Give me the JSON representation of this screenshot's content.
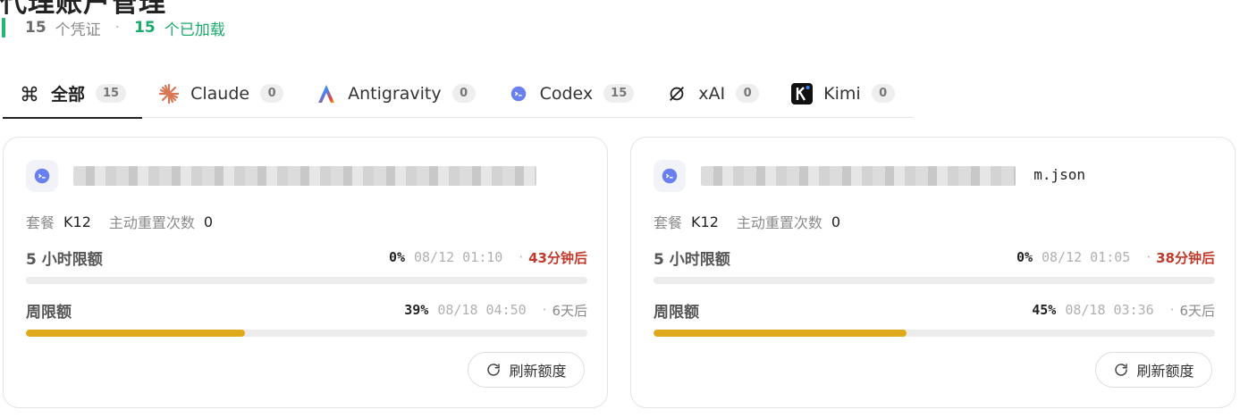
{
  "page": {
    "title": "代理账户管理"
  },
  "stats": {
    "total": "15",
    "total_label": "个凭证",
    "dot": "·",
    "loaded": "15",
    "loaded_label": "个已加载"
  },
  "tabs": [
    {
      "label": "全部",
      "count": "15",
      "icon": "command-icon",
      "active": true
    },
    {
      "label": "Claude",
      "count": "0",
      "icon": "claude-spark-icon"
    },
    {
      "label": "Antigravity",
      "count": "0",
      "icon": "antigravity-icon"
    },
    {
      "label": "Codex",
      "count": "15",
      "icon": "codex-icon"
    },
    {
      "label": "xAI",
      "count": "0",
      "icon": "xai-icon"
    },
    {
      "label": "Kimi",
      "count": "0",
      "icon": "kimi-icon"
    }
  ],
  "cards": [
    {
      "file_tail": "",
      "plan_label": "套餐",
      "plan": "K12",
      "reset_label": "主动重置次数",
      "reset_count": "0",
      "quota5h": {
        "title": "5 小时限额",
        "percent": 0,
        "percent_text": "0%",
        "time": "08/12 01:10",
        "sep": "·",
        "rel": "43分钟后"
      },
      "quota_week": {
        "title": "周限额",
        "percent": 39,
        "percent_text": "39%",
        "time": "08/18 04:50",
        "sep": "·",
        "rel": "6天后"
      },
      "refresh_label": "刷新额度"
    },
    {
      "file_tail": "m.json",
      "plan_label": "套餐",
      "plan": "K12",
      "reset_label": "主动重置次数",
      "reset_count": "0",
      "quota5h": {
        "title": "5 小时限额",
        "percent": 0,
        "percent_text": "0%",
        "time": "08/12 01:05",
        "sep": "·",
        "rel": "38分钟后"
      },
      "quota_week": {
        "title": "周限额",
        "percent": 45,
        "percent_text": "45%",
        "time": "08/18 03:36",
        "sep": "·",
        "rel": "6天后"
      },
      "refresh_label": "刷新额度"
    }
  ],
  "colors": {
    "accent_green": "#1aaa6a",
    "progress_fill": "#e0a91b",
    "warn_red": "#c0392b"
  }
}
